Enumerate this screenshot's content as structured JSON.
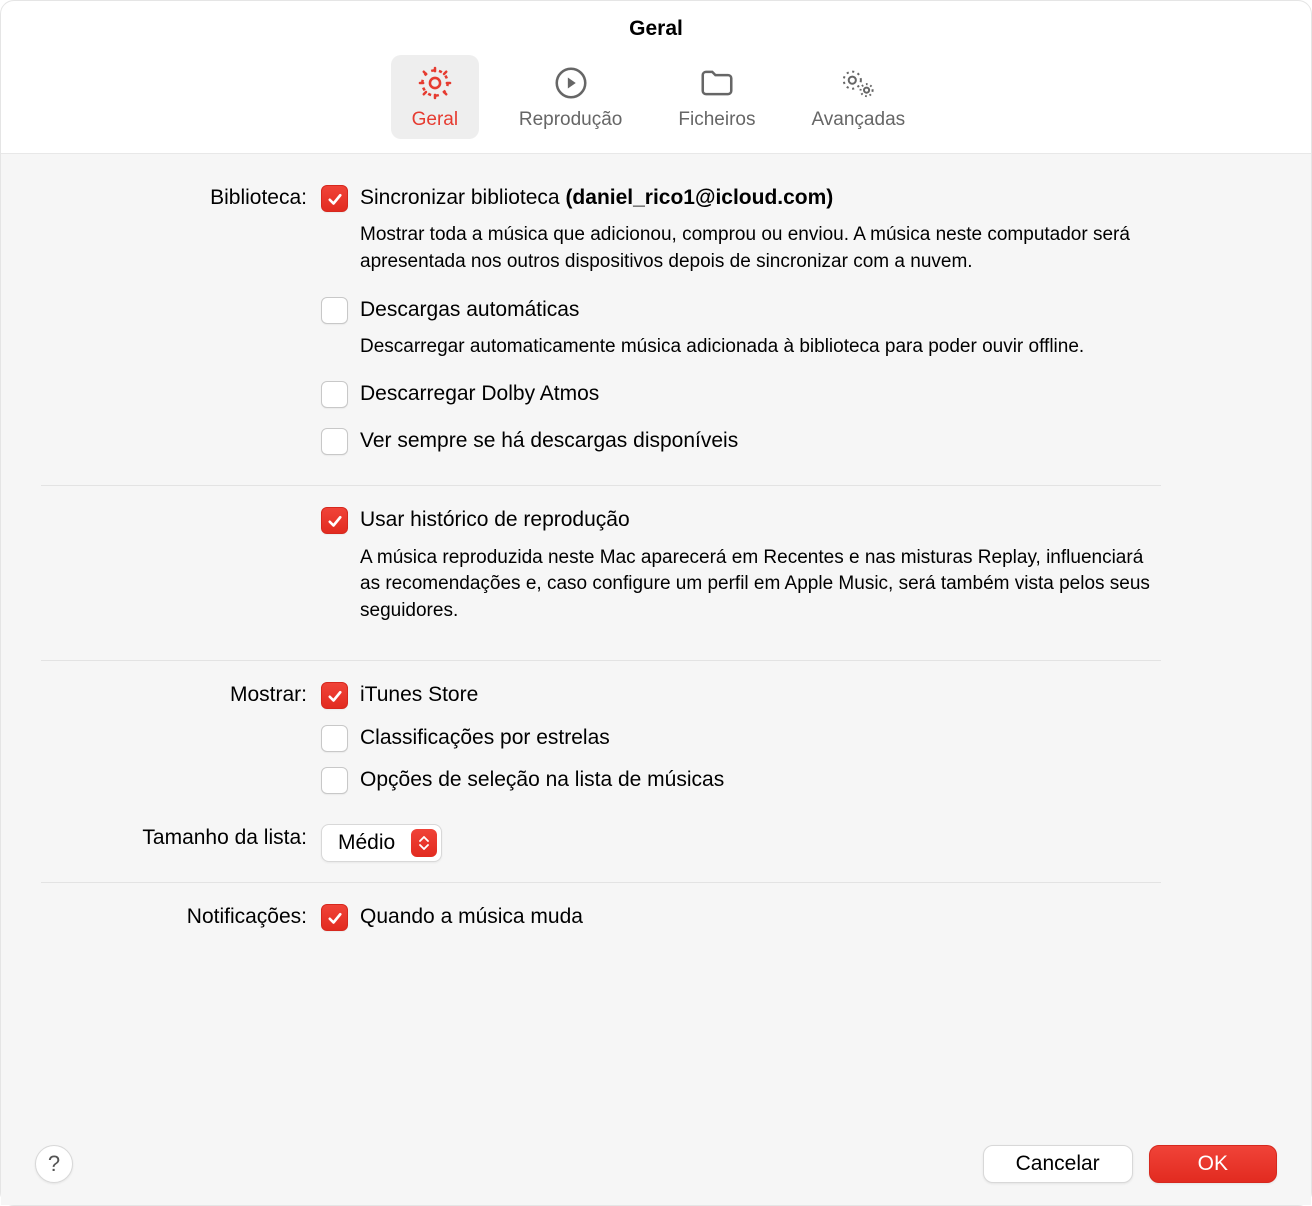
{
  "window": {
    "title": "Geral"
  },
  "tabs": {
    "general": "Geral",
    "playback": "Reprodução",
    "files": "Ficheiros",
    "advanced": "Avançadas"
  },
  "sections": {
    "library": {
      "label": "Biblioteca:",
      "sync": {
        "prefix": "Sincronizar biblioteca ",
        "account": "(daniel_rico1@icloud.com)",
        "checked": true,
        "desc": "Mostrar toda a música que adicionou, comprou ou enviou. A música neste computador será apresentada nos outros dispositivos depois de sincronizar com a nuvem."
      },
      "auto_downloads": {
        "label": "Descargas automáticas",
        "checked": false,
        "desc": "Descarregar automaticamente música adicionada à biblioteca para poder ouvir offline."
      },
      "dolby": {
        "label": "Descarregar Dolby Atmos",
        "checked": false
      },
      "check_downloads": {
        "label": "Ver sempre se há descargas disponíveis",
        "checked": false
      }
    },
    "history": {
      "label": "Usar histórico de reprodução",
      "checked": true,
      "desc": "A música reproduzida neste Mac aparecerá em Recentes e nas misturas Replay, influenciará as recomendações e, caso configure um perfil em Apple Music, será também vista pelos seus seguidores."
    },
    "show": {
      "label": "Mostrar:",
      "itunes": {
        "label": "iTunes Store",
        "checked": true
      },
      "stars": {
        "label": "Classificações por estrelas",
        "checked": false
      },
      "selection": {
        "label": "Opções de seleção na lista de músicas",
        "checked": false
      }
    },
    "list_size": {
      "label": "Tamanho da lista:",
      "value": "Médio"
    },
    "notifications": {
      "label": "Notificações:",
      "song_change": {
        "label": "Quando a música muda",
        "checked": true
      }
    }
  },
  "footer": {
    "help": "?",
    "cancel": "Cancelar",
    "ok": "OK"
  },
  "colors": {
    "accent": "#e63b30"
  }
}
